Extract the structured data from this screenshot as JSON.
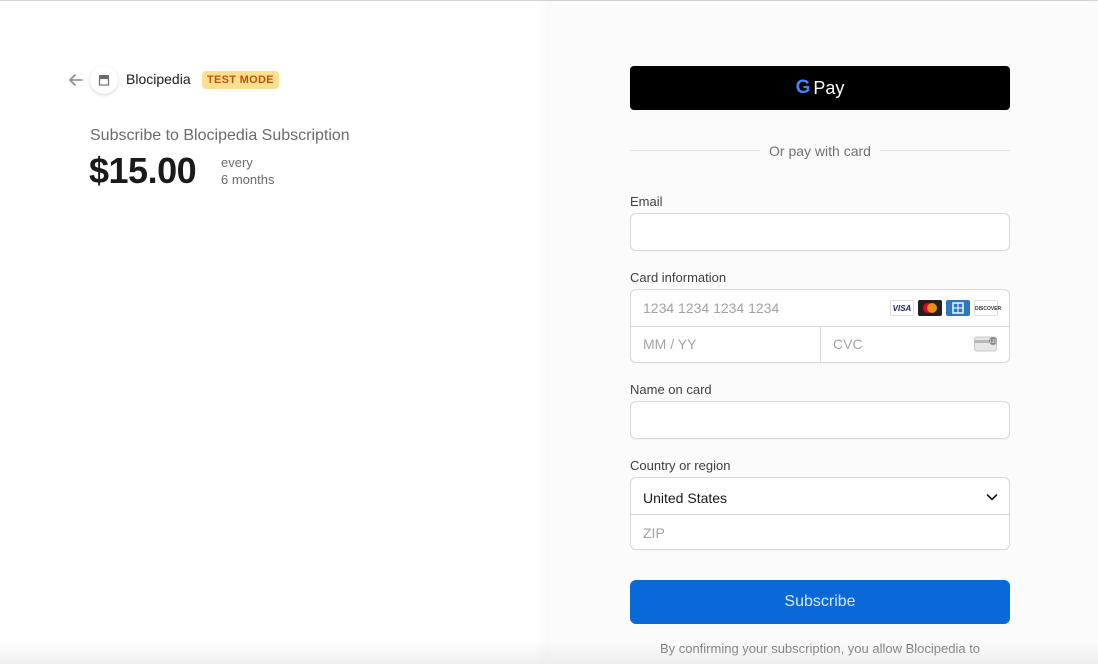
{
  "merchant": {
    "name": "Blocipedia",
    "badge": "TEST MODE",
    "subtitle": "Subscribe to Blocipedia Subscription",
    "price": "$15.00",
    "period_line1": "every",
    "period_line2": "6 months"
  },
  "wallet": {
    "g_letter": "G",
    "label": "Pay"
  },
  "divider_text": "Or pay with card",
  "email": {
    "label": "Email",
    "value": ""
  },
  "card": {
    "label": "Card information",
    "number_placeholder": "1234 1234 1234 1234",
    "expiry_placeholder": "MM / YY",
    "cvc_placeholder": "CVC",
    "brands": [
      "VISA",
      "mastercard",
      "amex",
      "DISCOVER"
    ]
  },
  "name_on_card": {
    "label": "Name on card",
    "value": ""
  },
  "country": {
    "label": "Country or region",
    "selected": "United States",
    "zip_placeholder": "ZIP"
  },
  "subscribe_label": "Subscribe",
  "consent_text": "By confirming your subscription, you allow Blocipedia to",
  "colors": {
    "accent": "#0a69d8",
    "badge_bg": "#ffde92",
    "badge_text": "#bb5504",
    "gpay_bg": "#000000"
  },
  "icons": [
    "back-arrow-icon",
    "store-icon",
    "google-g-icon",
    "visa-icon",
    "mastercard-icon",
    "amex-icon",
    "discover-icon",
    "cvc-card-icon",
    "chevron-down-icon"
  ]
}
